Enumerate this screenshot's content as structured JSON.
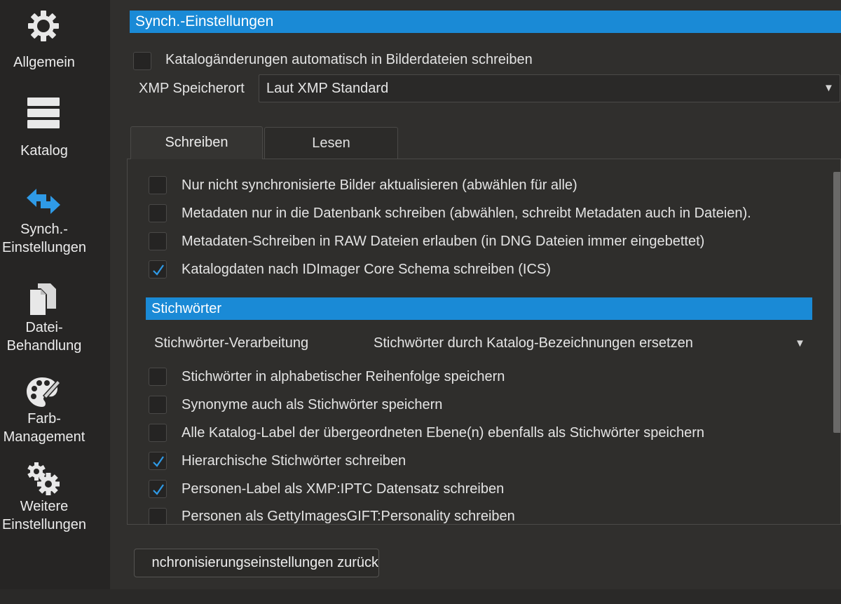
{
  "sidebar": {
    "items": [
      {
        "icon": "gear-icon",
        "label_lines": [
          "Allgemein"
        ]
      },
      {
        "icon": "catalog-stack-icon",
        "label_lines": [
          "Katalog"
        ]
      },
      {
        "icon": "sync-arrows-icon",
        "label_lines": [
          "Synch.-",
          "Einstellungen"
        ]
      },
      {
        "icon": "files-icon",
        "label_lines": [
          "Datei-",
          "Behandlung"
        ]
      },
      {
        "icon": "palette-icon",
        "label_lines": [
          "Farb-",
          "Management"
        ]
      },
      {
        "icon": "gears-icon",
        "label_lines": [
          "Weitere",
          "Einstellungen"
        ]
      }
    ]
  },
  "main": {
    "section_title": "Synch.-Einstellungen",
    "auto_write": {
      "label": "Katalogänderungen automatisch in Bilderdateien schreiben",
      "checked": false
    },
    "xmp": {
      "label": "XMP Speicherort",
      "value": "Laut XMP Standard"
    },
    "tabs": [
      {
        "label": "Schreiben",
        "active": true
      },
      {
        "label": "Lesen",
        "active": false
      }
    ],
    "write_options": [
      {
        "label": "Nur nicht synchronisierte Bilder aktualisieren (abwählen für alle)",
        "checked": false
      },
      {
        "label": "Metadaten nur in die Datenbank schreiben (abwählen, schreibt Metadaten auch in Dateien).",
        "checked": false
      },
      {
        "label": "Metadaten-Schreiben in RAW Dateien erlauben (in DNG Dateien immer eingebettet)",
        "checked": false
      },
      {
        "label": "Katalogdaten nach IDImager Core Schema schreiben (ICS)",
        "checked": true
      }
    ],
    "keywords": {
      "title": "Stichwörter",
      "processing_label": "Stichwörter-Verarbeitung",
      "processing_value": "Stichwörter durch Katalog-Bezeichnungen ersetzen",
      "options": [
        {
          "label": "Stichwörter in alphabetischer Reihenfolge speichern",
          "checked": false
        },
        {
          "label": "Synonyme auch als Stichwörter speichern",
          "checked": false
        },
        {
          "label": "Alle Katalog-Label der übergeordneten Ebene(n) ebenfalls als Stichwörter speichern",
          "checked": false
        },
        {
          "label": "Hierarchische Stichwörter schreiben",
          "checked": true
        },
        {
          "label": "Personen-Label als XMP:IPTC Datensatz schreiben",
          "checked": true
        },
        {
          "label": "Personen als  GettyImagesGIFT:Personality schreiben",
          "checked": false
        }
      ]
    },
    "reset_button": "nchronisierungseinstellungen zurück"
  },
  "colors": {
    "accent": "#1a8ad6",
    "check": "#2f9ae6",
    "background": "#302f2d",
    "sidebar": "#262524"
  }
}
